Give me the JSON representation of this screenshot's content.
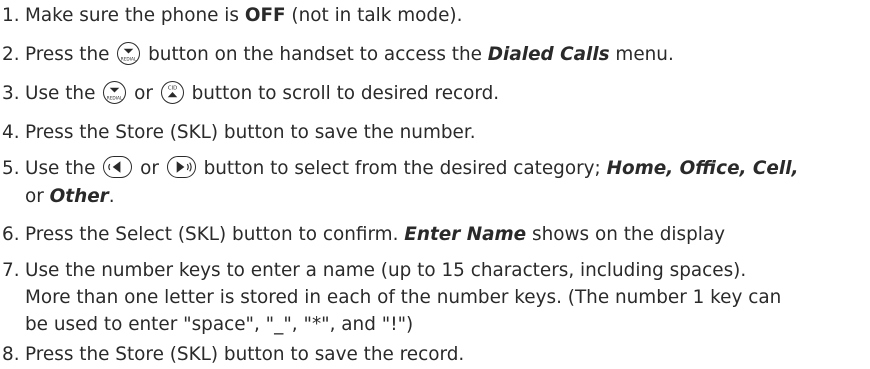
{
  "steps": [
    {
      "num": "1.",
      "a": "Make sure the phone is ",
      "b1": "OFF",
      "c": " (not in talk mode)."
    },
    {
      "num": "2.",
      "a": "Press the ",
      "icon": "redial-down-icon",
      "b": " button on the handset to access the ",
      "bi1": "Dialed Calls",
      "c": " menu."
    },
    {
      "num": "3.",
      "a": "Use the ",
      "icon1": "redial-down-icon",
      "mid": " or ",
      "icon2": "cid-up-icon",
      "c": " button to scroll to desired record."
    },
    {
      "num": "4.",
      "a": "Press the Store (SKL) button to save the number."
    },
    {
      "num": "5.",
      "a": "Use the ",
      "icon1": "volume-left-icon",
      "mid": "  or ",
      "icon2": "volume-right-icon",
      "b": "  button to select from the desired category; ",
      "bi1": "Home, Office, Cell,",
      "line2a": "or ",
      "bi2": "Other",
      "line2b": "."
    },
    {
      "num": "6.",
      "a": "Press the Select (SKL) button to confirm. ",
      "bi1": "Enter Name",
      "c": " shows on the display"
    },
    {
      "num": "7.",
      "line1": "Use the number keys to enter a name (up to 15 characters, including spaces).",
      "line2": "More than one letter is stored in each of the number keys. (The number 1 key can",
      "line3": "be used to enter \"space\", \"_\", \"*\", and \"!\")"
    },
    {
      "num": "8.",
      "a": "Press the Store (SKL) button to save the record."
    }
  ]
}
